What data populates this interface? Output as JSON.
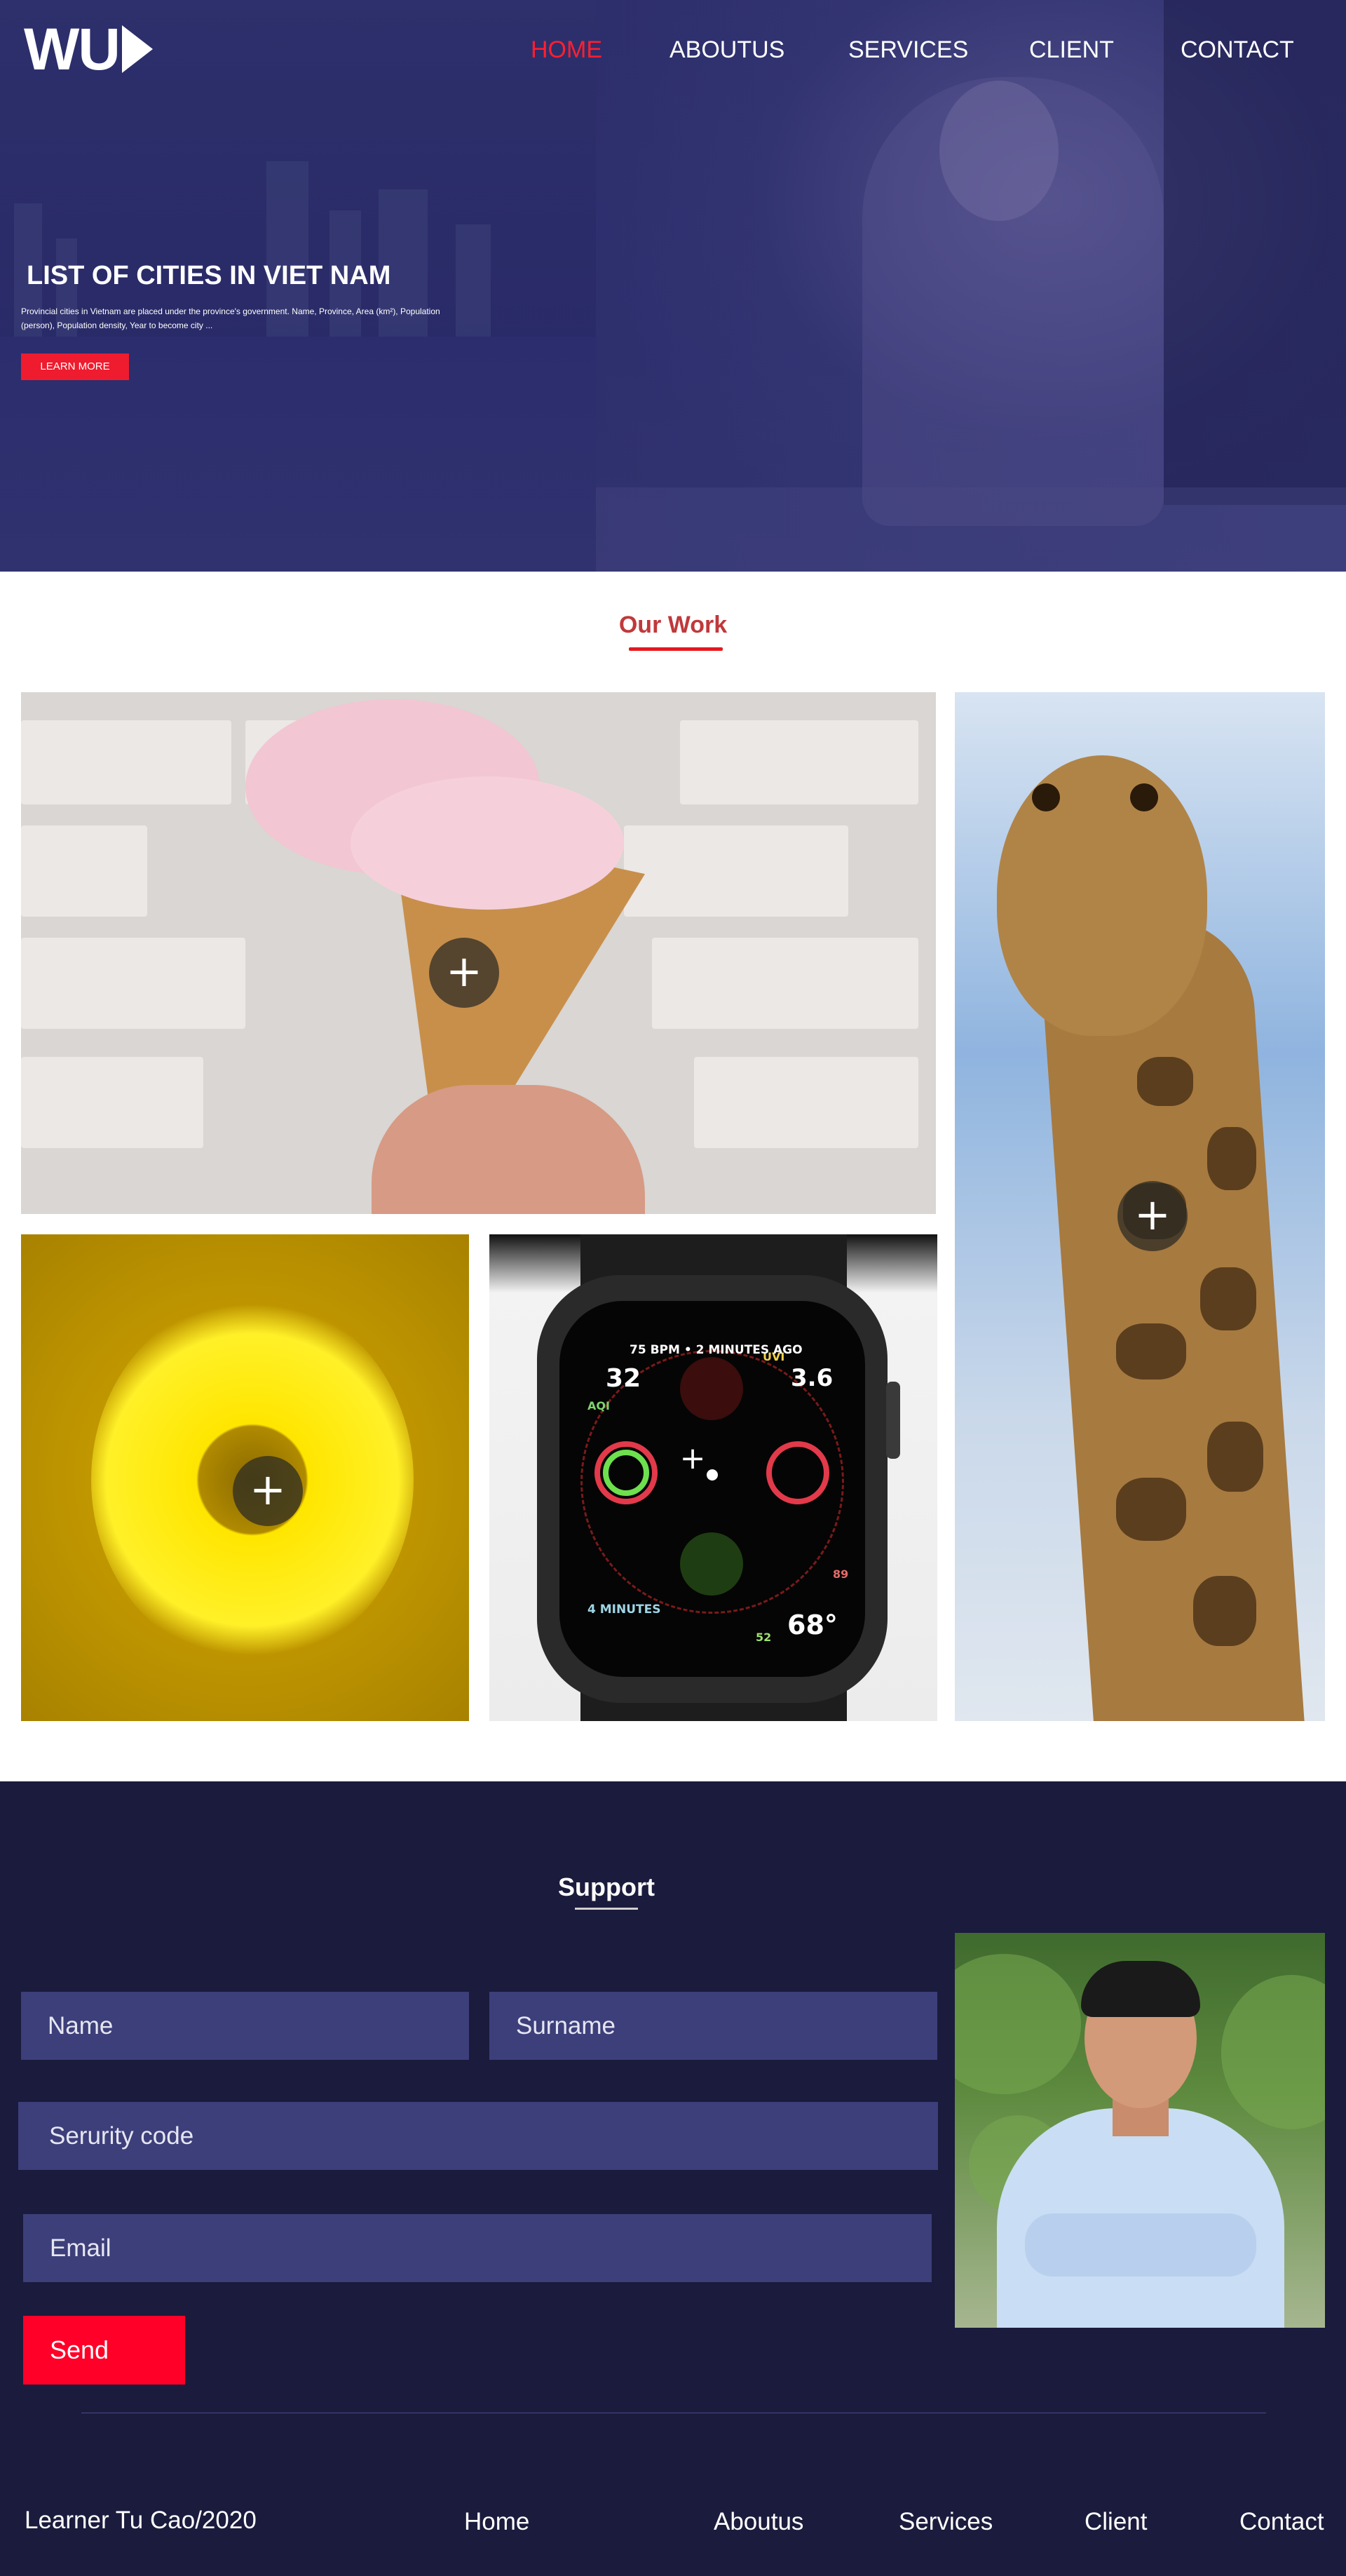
{
  "header": {
    "logo": "WU",
    "nav": [
      {
        "label": "HOME",
        "active": true
      },
      {
        "label": "ABOUTUS",
        "active": false
      },
      {
        "label": "SERVICES",
        "active": false
      },
      {
        "label": "CLIENT",
        "active": false
      },
      {
        "label": "CONTACT",
        "active": false
      }
    ]
  },
  "hero": {
    "title": "LIST OF CITIES IN VIET NAM",
    "description": "Provincial cities in Vietnam are placed under the province's government. Name, Province, Area (km²), Population (person), Population density, Year to become city ...",
    "cta_label": "LEARN MORE"
  },
  "work": {
    "title": "Our Work",
    "tiles": [
      {
        "subject": "ice cream cone",
        "overlay_icon": "+"
      },
      {
        "subject": "giraffe",
        "overlay_icon": "+"
      },
      {
        "subject": "yellow flower",
        "overlay_icon": "+"
      },
      {
        "subject": "smart watch",
        "overlay_icon": "+"
      }
    ],
    "watch_face": {
      "top_text": "75 BPM • 2 MINUTES AGO",
      "left_value": "32",
      "left_label": "AQI",
      "right_value": "3.6",
      "right_label": "UVI",
      "bottom_left": "4 MINUTES",
      "bottom_right_value": "68°",
      "bottom_right_small": "52",
      "side_small": "89"
    }
  },
  "support": {
    "title": "Support",
    "fields": {
      "name_placeholder": "Name",
      "surname_placeholder": "Surname",
      "security_placeholder": "Serurity code",
      "email_placeholder": "Email"
    },
    "send_label": "Send"
  },
  "footer": {
    "copyright": "Learner Tu Cao/2020",
    "links": [
      "Home",
      "Aboutus",
      "Services",
      "Client",
      "Contact"
    ]
  },
  "colors": {
    "accent": "#ee1c2e",
    "hero_overlay": "#2a2b6a",
    "support_bg": "#1b1b3d",
    "field_bg": "#3d3f7a"
  }
}
